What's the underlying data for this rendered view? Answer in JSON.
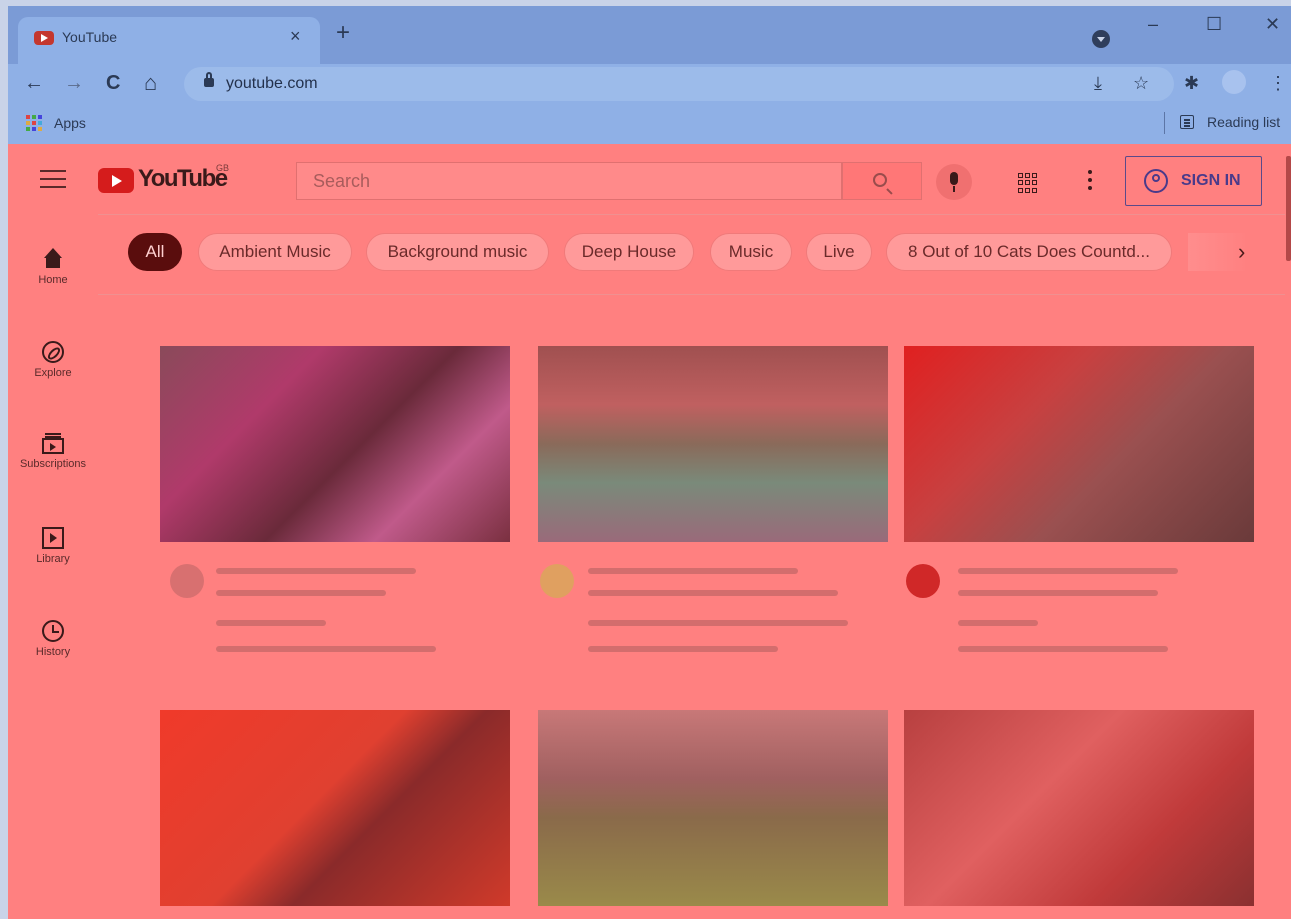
{
  "browser": {
    "tab": {
      "title": "YouTube",
      "close": "×"
    },
    "new_tab": "+",
    "window_controls": {
      "minimize": "–",
      "maximize": "☐",
      "close": "✕"
    },
    "nav": {
      "back": "←",
      "forward": "→",
      "reload": "C",
      "home": "⌂"
    },
    "address": {
      "url": "youtube.com"
    },
    "toolbar_icons": {
      "install": "⤓",
      "bookmark": "☆",
      "extensions": "✱",
      "menu": "⋮"
    },
    "bookmarks": {
      "apps_label": "Apps",
      "reading_list_label": "Reading list"
    }
  },
  "youtube": {
    "logo_text": "YouTube",
    "region": "GB",
    "search": {
      "placeholder": "Search"
    },
    "sign_in": "SIGN IN",
    "chips": [
      "All",
      "Ambient Music",
      "Background music",
      "Deep House",
      "Music",
      "Live",
      "8 Out of 10 Cats Does Countd..."
    ],
    "chip_next": "›",
    "sidebar": [
      {
        "label": "Home"
      },
      {
        "label": "Explore"
      },
      {
        "label": "Subscriptions"
      },
      {
        "label": "Library"
      },
      {
        "label": "History"
      }
    ]
  },
  "colors": {
    "page_overlay": "#ff8080",
    "browser_chrome": "#8fb0e6",
    "brand_red": "#d51c1c",
    "active_chip": "#5a0d0d"
  }
}
